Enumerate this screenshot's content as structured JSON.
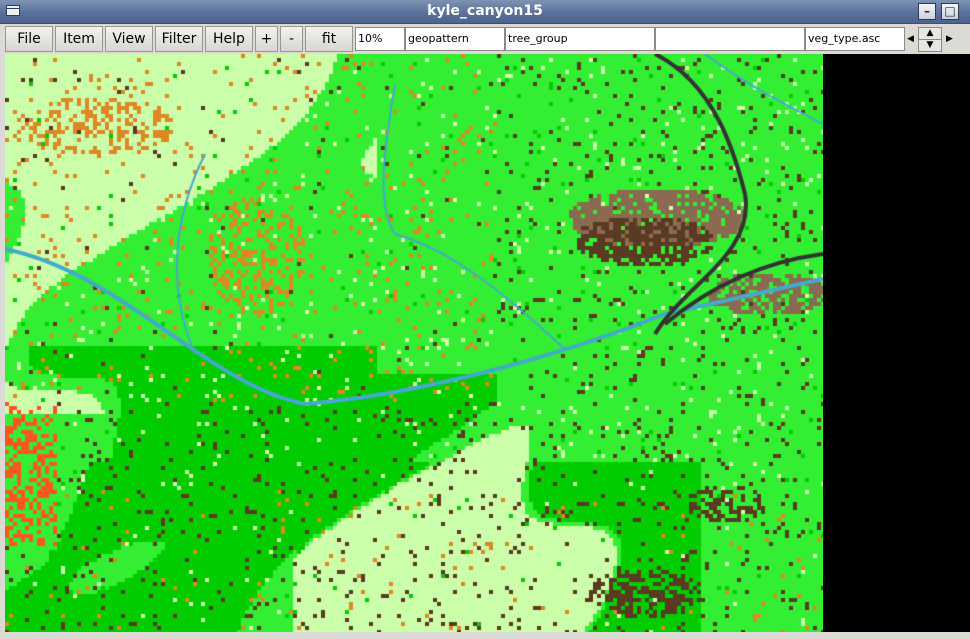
{
  "window": {
    "title": "kyle_canyon15"
  },
  "toolbar": {
    "menus": [
      "File",
      "Item",
      "View",
      "Filter",
      "Help"
    ],
    "zoom_in": "+",
    "zoom_out": "-",
    "fit": "fit",
    "zoom_level": "10%",
    "field1": "geopattern",
    "field2": "tree_group",
    "field3": "",
    "file_name": "veg_type.asc"
  },
  "map": {
    "palette": {
      "bright_green": "#33ee33",
      "pale_green": "#ccffaa",
      "mid_green": "#00cc00",
      "light_green": "#66ff66",
      "orange": "#dd8822",
      "brown": "#8a6a50",
      "dark_brown": "#5a3a20",
      "red_orange": "#ff5522",
      "river": "#44aacc",
      "road": "#333333"
    }
  }
}
